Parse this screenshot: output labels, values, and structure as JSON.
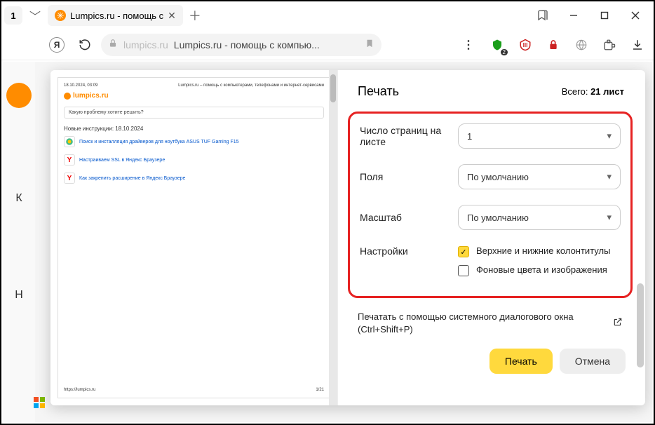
{
  "titlebar": {
    "tab_count": "1",
    "tab_title": "Lumpics.ru - помощь с"
  },
  "toolbar": {
    "yandex_letter": "Я",
    "domain": "lumpics.ru",
    "page_title": "Lumpics.ru - помощь с компью...",
    "badge": "2"
  },
  "background": {
    "k": "К",
    "h": "Н"
  },
  "preview": {
    "date": "18.10.2024, 03:09",
    "subtitle": "Lumpics.ru – помощь с компьютерами, телефонами и интернет-сервисами",
    "logo": "lumpics.ru",
    "search_placeholder": "Какую проблему хотите решить?",
    "new_header": "Новые инструкции: 18.10.2024",
    "items": [
      "Поиск и инсталляция драйверов для ноутбука ASUS TUF Gaming F15",
      "Настраиваем SSL в Яндекс Браузере",
      "Как закрепить расширение в Яндекс Браузере"
    ],
    "footer_url": "https://lumpics.ru",
    "footer_page": "1/21"
  },
  "print": {
    "header": "Печать",
    "total_label": "Всего:",
    "total_value": "21 лист",
    "rows": {
      "pages_per_sheet": {
        "label": "Число страниц на листе",
        "value": "1"
      },
      "margins": {
        "label": "Поля",
        "value": "По умолчанию"
      },
      "scale": {
        "label": "Масштаб",
        "value": "По умолчанию"
      },
      "settings_label": "Настройки",
      "headers_footers": "Верхние и нижние колонтитулы",
      "background": "Фоновые цвета и изображения"
    },
    "system_dialog": "Печатать с помощью системного диалогового окна (Ctrl+Shift+P)",
    "print_btn": "Печать",
    "cancel_btn": "Отмена"
  }
}
